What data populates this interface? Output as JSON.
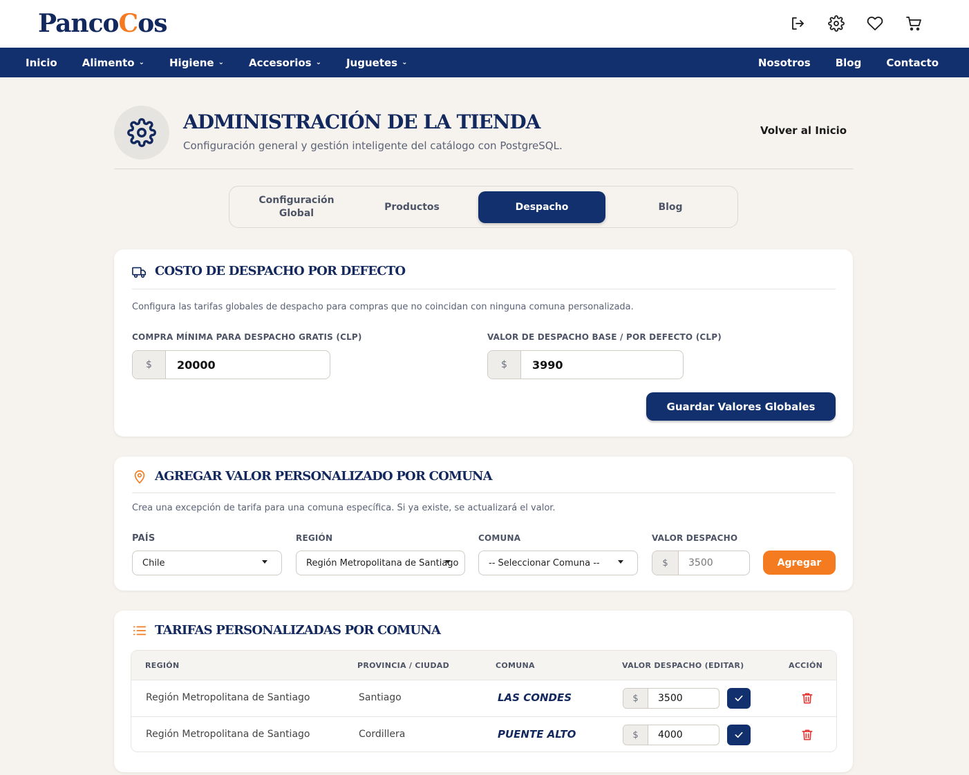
{
  "brand": {
    "logo_prefix": "Panco",
    "logo_accent": "C",
    "logo_suffix": "os"
  },
  "colors": {
    "navy": "#12306e",
    "accent": "#f47b20",
    "danger": "#e53935",
    "background": "#f6f3ee"
  },
  "header_icons": [
    "logout-icon",
    "gear-icon",
    "heart-icon",
    "cart-icon"
  ],
  "nav": {
    "left": [
      {
        "label": "Inicio",
        "has_dropdown": false
      },
      {
        "label": "Alimento",
        "has_dropdown": true
      },
      {
        "label": "Higiene",
        "has_dropdown": true
      },
      {
        "label": "Accesorios",
        "has_dropdown": true
      },
      {
        "label": "Juguetes",
        "has_dropdown": true
      }
    ],
    "right": [
      "Nosotros",
      "Blog",
      "Contacto"
    ]
  },
  "page": {
    "title": "ADMINISTRACIÓN DE LA TIENDA",
    "subtitle": "Configuración general y gestión inteligente del catálogo con PostgreSQL.",
    "back_link": "Volver al Inicio",
    "icon": "gear-icon"
  },
  "tabs": [
    {
      "label_line1": "Configuración",
      "label_line2": "Global",
      "active": false
    },
    {
      "label_line1": "Productos",
      "label_line2": "",
      "active": false
    },
    {
      "label_line1": "Despacho",
      "label_line2": "",
      "active": true
    },
    {
      "label_line1": "Blog",
      "label_line2": "",
      "active": false
    }
  ],
  "default_shipping": {
    "title": "COSTO DE DESPACHO POR DEFECTO",
    "icon": "truck-icon",
    "description": "Configura las tarifas globales de despacho para compras que no coincidan con ninguna comuna personalizada.",
    "min_purchase_label": "COMPRA MÍNIMA PARA DESPACHO GRATIS (CLP)",
    "min_purchase_value": "20000",
    "base_value_label": "VALOR DE DESPACHO BASE / POR DEFECTO (CLP)",
    "base_value": "3990",
    "currency_symbol": "$",
    "save_button": "Guardar Valores Globales"
  },
  "custom_commune": {
    "title": "AGREGAR VALOR PERSONALIZADO POR COMUNA",
    "icon": "map-pin-icon",
    "description": "Crea una excepción de tarifa para una comuna específica. Si ya existe, se actualizará el valor.",
    "country_label": "PAÍS",
    "country_value": "Chile",
    "region_label": "REGIÓN",
    "region_value": "Región Metropolitana de Santiago",
    "commune_label": "COMUNA",
    "commune_placeholder": "-- Seleccionar Comuna --",
    "value_label": "VALOR DESPACHO",
    "value_placeholder": "3500",
    "currency_symbol": "$",
    "add_button": "Agregar"
  },
  "custom_rates": {
    "title": "TARIFAS PERSONALIZADAS POR COMUNA",
    "icon": "list-icon",
    "columns": [
      "REGIÓN",
      "PROVINCIA / CIUDAD",
      "COMUNA",
      "VALOR DESPACHO (EDITAR)",
      "ACCIÓN"
    ],
    "currency_symbol": "$",
    "rows": [
      {
        "region": "Región Metropolitana de Santiago",
        "provincia": "Santiago",
        "comuna": "LAS CONDES",
        "valor": "3500"
      },
      {
        "region": "Región Metropolitana de Santiago",
        "provincia": "Cordillera",
        "comuna": "PUENTE ALTO",
        "valor": "4000"
      }
    ]
  }
}
